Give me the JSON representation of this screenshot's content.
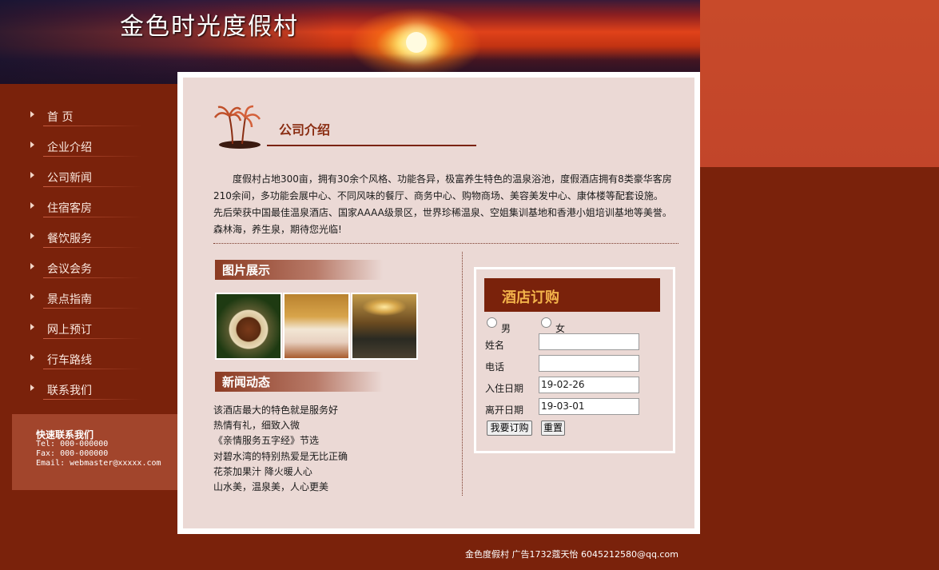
{
  "header": {
    "site_title": "金色时光度假村"
  },
  "nav": {
    "items": [
      {
        "label": "首 页"
      },
      {
        "label": "企业介绍"
      },
      {
        "label": "公司新闻"
      },
      {
        "label": "住宿客房"
      },
      {
        "label": "餐饮服务"
      },
      {
        "label": "会议会务"
      },
      {
        "label": "景点指南"
      },
      {
        "label": "网上预订"
      },
      {
        "label": "行车路线"
      },
      {
        "label": "联系我们"
      }
    ]
  },
  "contact": {
    "title": "快速联系我们",
    "tel": "Tel: 000-000000",
    "fax": "Fax: 000-000000",
    "email": "Email: webmaster@xxxxx.com"
  },
  "intro": {
    "title": "公司介绍",
    "text": "度假村占地300亩，拥有30余个风格、功能各异，极富养生特色的温泉浴池，度假酒店拥有8类豪华客房210余间，多功能会展中心、不同风味的餐厅、商务中心、购物商场、美容美发中心、康体楼等配套设施。先后荣获中国最佳温泉酒店、国家AAAA级景区，世界珍稀温泉、空姐集训基地和香港小姐培训基地等美誉。 森林海，养生泉，期待您光临!"
  },
  "gallery": {
    "title": "图片展示"
  },
  "news": {
    "title": "新闻动态",
    "items": [
      "该酒店最大的特色就是服务好",
      "热情有礼，细致入微",
      "《亲情服务五字经》节选",
      "对碧水湾的特别热爱是无比正确",
      "花茶加果汁 降火暖人心",
      "山水美，温泉美，人心更美"
    ]
  },
  "booking": {
    "title": "酒店订购",
    "gender_male": "男",
    "gender_female": "女",
    "name_label": "姓名",
    "name_value": "",
    "phone_label": "电话",
    "phone_value": "",
    "checkin_label": "入住日期",
    "checkin_value": "19-02-26",
    "checkout_label": "离开日期",
    "checkout_value": "19-03-01",
    "submit_label": "我要订购",
    "reset_label": "重置"
  },
  "footer": {
    "text": "金色度假村 广告1732蔻天怡 6045212580@qq.com"
  }
}
